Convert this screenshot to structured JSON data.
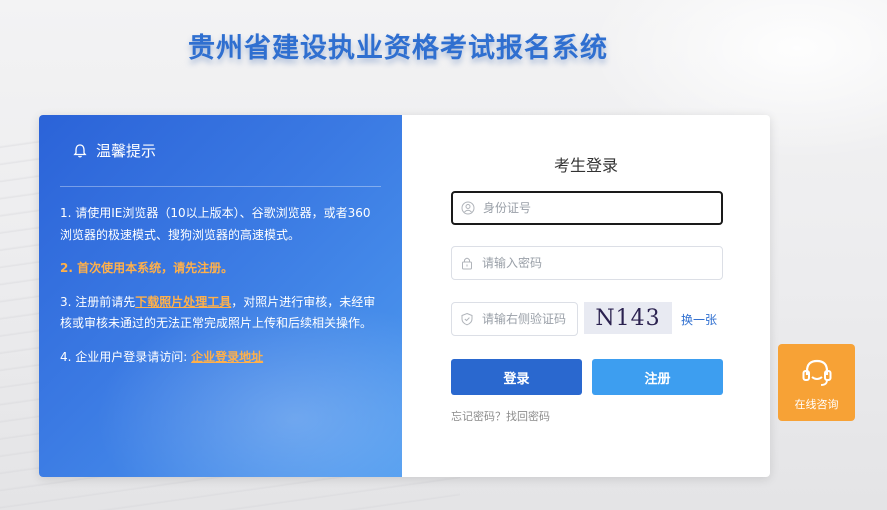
{
  "site_title": "贵州省建设执业资格考试报名系统",
  "tips": {
    "heading": "温馨提示",
    "items": [
      {
        "text": "1. 请使用IE浏览器（10以上版本）、谷歌浏览器，或者360浏览器的极速模式、搜狗浏览器的高速模式。"
      },
      {
        "text": "2. 首次使用本系统，请先注册。"
      },
      {
        "prefix": "3. 注册前请先",
        "link": "下载照片处理工具",
        "suffix": "，对照片进行审核，未经审核或审核未通过的无法正常完成照片上传和后续相关操作。"
      },
      {
        "prefix": "4. 企业用户登录请访问: ",
        "link": "企业登录地址"
      }
    ]
  },
  "login": {
    "title": "考生登录",
    "id_placeholder": "身份证号",
    "password_placeholder": "请输入密码",
    "captcha_placeholder": "请输右侧验证码",
    "captcha_text": "N143",
    "refresh_label": "换一张",
    "login_button": "登录",
    "register_button": "注册",
    "forgot_label": "忘记密码？找回密码"
  },
  "consult": {
    "label": "在线咨询"
  },
  "colors": {
    "primary": "#2a68cf",
    "secondary": "#3d9ef0",
    "accent": "#f7a236",
    "tip_highlight": "#ffb04a"
  }
}
